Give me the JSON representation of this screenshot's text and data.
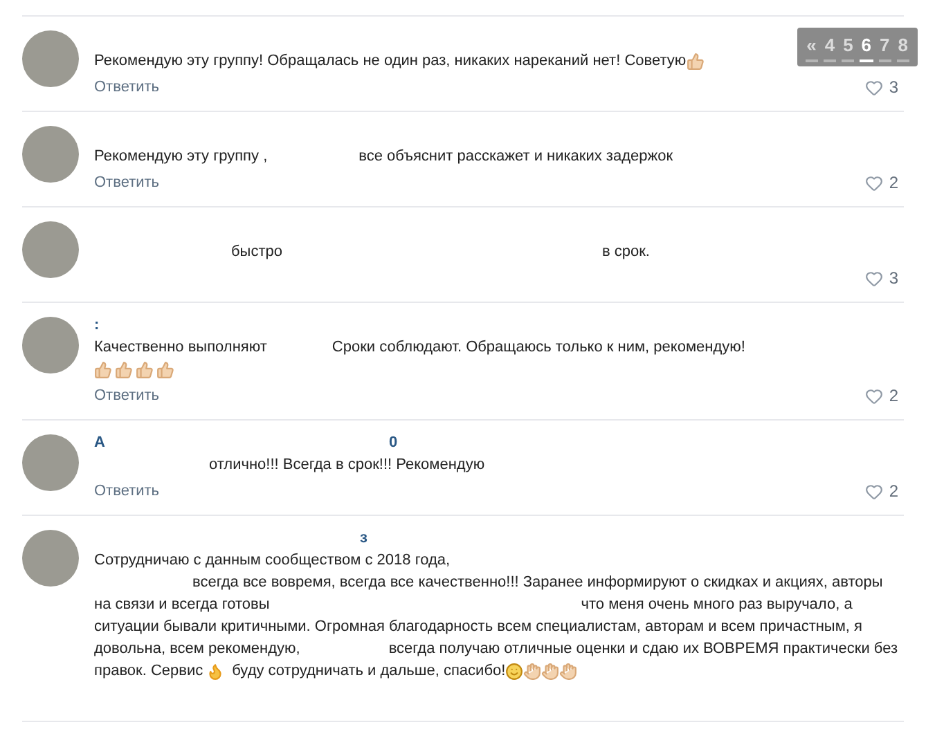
{
  "pagination": [
    {
      "label": "«",
      "selected": false
    },
    {
      "label": "4",
      "selected": false
    },
    {
      "label": "5",
      "selected": false
    },
    {
      "label": "6",
      "selected": true
    },
    {
      "label": "7",
      "selected": false
    },
    {
      "label": "8",
      "selected": false
    }
  ],
  "comments": [
    {
      "lines": [
        [
          {
            "kind": "text",
            "text": "Рекомендую эту группу! Обращалась не один раз, никаких нареканий нет! Советую"
          },
          {
            "kind": "thumbs"
          }
        ]
      ],
      "reply": "Ответить",
      "likes": "3"
    },
    {
      "lines": [
        [
          {
            "kind": "text",
            "text": "Рекомендую эту группу ,"
          },
          {
            "kind": "text",
            "text": "все объяснит расскажет и никаких задержок"
          }
        ]
      ],
      "reply": "Ответить",
      "likes": "2"
    },
    {
      "lines": [
        [
          {
            "kind": "text",
            "text": "быстро"
          },
          {
            "kind": "text",
            "text": "в срок."
          }
        ]
      ],
      "likes": "3"
    },
    {
      "author": [
        ":"
      ],
      "lines": [
        [
          {
            "kind": "text",
            "text": "Качественно выполняют"
          },
          {
            "kind": "text",
            "text": "Сроки соблюдают. Обращаюсь только к ним, рекомендую!"
          }
        ],
        [
          {
            "kind": "thumbs"
          },
          {
            "kind": "thumbs"
          },
          {
            "kind": "thumbs"
          },
          {
            "kind": "thumbs"
          }
        ]
      ],
      "reply": "Ответить",
      "likes": "2"
    },
    {
      "author": [
        "А",
        "0"
      ],
      "lines": [
        [
          {
            "kind": "text",
            "text": "отлично!!! Всегда в срок!!! Рекомендую"
          }
        ]
      ],
      "reply": "Ответить",
      "likes": "2"
    },
    {
      "author": [
        "з"
      ],
      "lines": [
        [
          {
            "kind": "text",
            "text": "Сотрудничаю с данным сообществом с 2018 года,"
          }
        ],
        [
          {
            "kind": "text",
            "text": "всегда все вовремя, всегда все качественно!!! Заранее информируют о скидках и акциях, авторы"
          }
        ],
        [
          {
            "kind": "text",
            "text": "на связи и всегда готовы"
          },
          {
            "kind": "text",
            "text": "что меня очень много раз выручало, а"
          }
        ],
        [
          {
            "kind": "text",
            "text": "ситуации бывали критичными. Огромная благодарность всем специалистам, авторам и всем причастным, я"
          }
        ],
        [
          {
            "kind": "text",
            "text": "довольна, всем рекомендую,"
          },
          {
            "kind": "text",
            "text": "всегда получаю отличные оценки и сдаю их ВОВРЕМЯ практически без"
          }
        ],
        [
          {
            "kind": "text",
            "text": "правок. Сервис"
          },
          {
            "kind": "fire"
          },
          {
            "kind": "text",
            "text": "буду сотрудничать и дальше, спасибо!"
          },
          {
            "kind": "smiley"
          },
          {
            "kind": "clap"
          },
          {
            "kind": "clap"
          },
          {
            "kind": "clap"
          }
        ]
      ]
    }
  ]
}
